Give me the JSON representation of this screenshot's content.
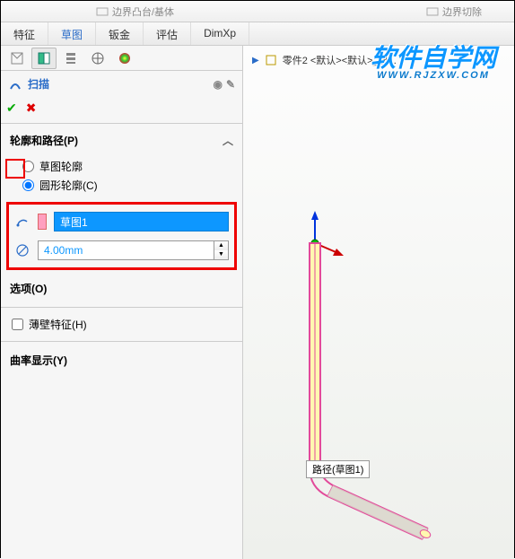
{
  "top_toolbar": {
    "boss_base": "边界凸台/基体",
    "boundary_cut": "边界切除"
  },
  "tabs": {
    "feature": "特征",
    "sketch": "草图",
    "sheet_metal": "钣金",
    "evaluate": "评估",
    "dimxpert": "DimXp"
  },
  "feature_header": {
    "title": "扫描",
    "help_tip": "?"
  },
  "sections": {
    "profile_path": {
      "title": "轮廓和路径(P)",
      "radio_sketch": "草图轮廓",
      "radio_circle": "圆形轮廓(C)"
    },
    "path_input": "草图1",
    "diameter_input": "4.00mm",
    "options": "选项(O)",
    "thin_feature": "薄壁特征(H)",
    "curvature": "曲率显示(Y)"
  },
  "viewport": {
    "crumb": "零件2 <默认><默认>_显...",
    "tooltip": "路径(草图1)"
  },
  "watermark": {
    "main": "软件自学网",
    "sub": "WWW.RJZXW.COM"
  }
}
